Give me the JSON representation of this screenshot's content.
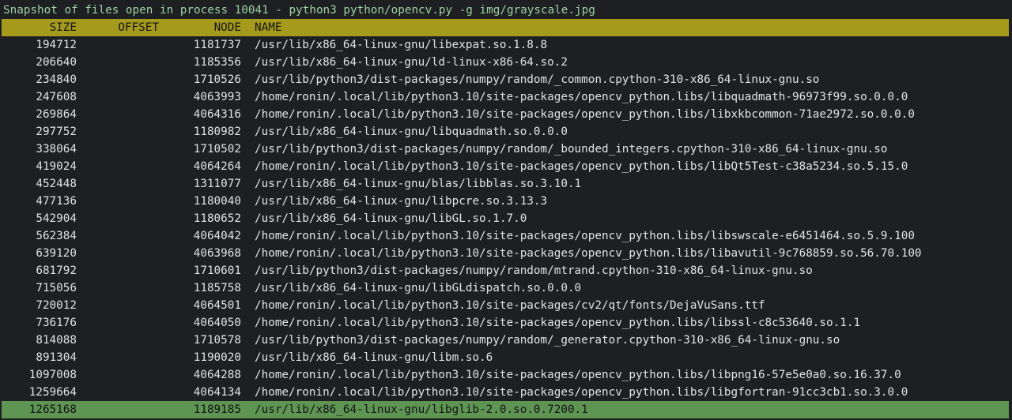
{
  "window": {
    "title": "Snapshot of files open in process 10041 - python3 python/opencv.py -g img/grayscale.jpg"
  },
  "table": {
    "columns": [
      "SIZE",
      "OFFSET",
      "NODE",
      "NAME"
    ],
    "selected_index": 21,
    "rows": [
      {
        "size": "194712",
        "offset": "",
        "node": "1181737",
        "name": "/usr/lib/x86_64-linux-gnu/libexpat.so.1.8.8"
      },
      {
        "size": "206640",
        "offset": "",
        "node": "1185356",
        "name": "/usr/lib/x86_64-linux-gnu/ld-linux-x86-64.so.2"
      },
      {
        "size": "234840",
        "offset": "",
        "node": "1710526",
        "name": "/usr/lib/python3/dist-packages/numpy/random/_common.cpython-310-x86_64-linux-gnu.so"
      },
      {
        "size": "247608",
        "offset": "",
        "node": "4063993",
        "name": "/home/ronin/.local/lib/python3.10/site-packages/opencv_python.libs/libquadmath-96973f99.so.0.0.0"
      },
      {
        "size": "269864",
        "offset": "",
        "node": "4064316",
        "name": "/home/ronin/.local/lib/python3.10/site-packages/opencv_python.libs/libxkbcommon-71ae2972.so.0.0.0"
      },
      {
        "size": "297752",
        "offset": "",
        "node": "1180982",
        "name": "/usr/lib/x86_64-linux-gnu/libquadmath.so.0.0.0"
      },
      {
        "size": "338064",
        "offset": "",
        "node": "1710502",
        "name": "/usr/lib/python3/dist-packages/numpy/random/_bounded_integers.cpython-310-x86_64-linux-gnu.so"
      },
      {
        "size": "419024",
        "offset": "",
        "node": "4064264",
        "name": "/home/ronin/.local/lib/python3.10/site-packages/opencv_python.libs/libQt5Test-c38a5234.so.5.15.0"
      },
      {
        "size": "452448",
        "offset": "",
        "node": "1311077",
        "name": "/usr/lib/x86_64-linux-gnu/blas/libblas.so.3.10.1"
      },
      {
        "size": "477136",
        "offset": "",
        "node": "1180040",
        "name": "/usr/lib/x86_64-linux-gnu/libpcre.so.3.13.3"
      },
      {
        "size": "542904",
        "offset": "",
        "node": "1180652",
        "name": "/usr/lib/x86_64-linux-gnu/libGL.so.1.7.0"
      },
      {
        "size": "562384",
        "offset": "",
        "node": "4064042",
        "name": "/home/ronin/.local/lib/python3.10/site-packages/opencv_python.libs/libswscale-e6451464.so.5.9.100"
      },
      {
        "size": "639120",
        "offset": "",
        "node": "4063968",
        "name": "/home/ronin/.local/lib/python3.10/site-packages/opencv_python.libs/libavutil-9c768859.so.56.70.100"
      },
      {
        "size": "681792",
        "offset": "",
        "node": "1710601",
        "name": "/usr/lib/python3/dist-packages/numpy/random/mtrand.cpython-310-x86_64-linux-gnu.so"
      },
      {
        "size": "715056",
        "offset": "",
        "node": "1185758",
        "name": "/usr/lib/x86_64-linux-gnu/libGLdispatch.so.0.0.0"
      },
      {
        "size": "720012",
        "offset": "",
        "node": "4064501",
        "name": "/home/ronin/.local/lib/python3.10/site-packages/cv2/qt/fonts/DejaVuSans.ttf"
      },
      {
        "size": "736176",
        "offset": "",
        "node": "4064050",
        "name": "/home/ronin/.local/lib/python3.10/site-packages/opencv_python.libs/libssl-c8c53640.so.1.1"
      },
      {
        "size": "814088",
        "offset": "",
        "node": "1710578",
        "name": "/usr/lib/python3/dist-packages/numpy/random/_generator.cpython-310-x86_64-linux-gnu.so"
      },
      {
        "size": "891304",
        "offset": "",
        "node": "1190020",
        "name": "/usr/lib/x86_64-linux-gnu/libm.so.6"
      },
      {
        "size": "1097008",
        "offset": "",
        "node": "4064288",
        "name": "/home/ronin/.local/lib/python3.10/site-packages/opencv_python.libs/libpng16-57e5e0a0.so.16.37.0"
      },
      {
        "size": "1259664",
        "offset": "",
        "node": "4064134",
        "name": "/home/ronin/.local/lib/python3.10/site-packages/opencv_python.libs/libgfortran-91cc3cb1.so.3.0.0"
      },
      {
        "size": "1265168",
        "offset": "",
        "node": "1189185",
        "name": "/usr/lib/x86_64-linux-gnu/libglib-2.0.so.0.7200.1"
      }
    ]
  },
  "colors": {
    "background": "#1e1f23",
    "title_text": "#9cd1a0",
    "header_bg": "#a59a1c",
    "selected_bg": "#5e9553"
  }
}
